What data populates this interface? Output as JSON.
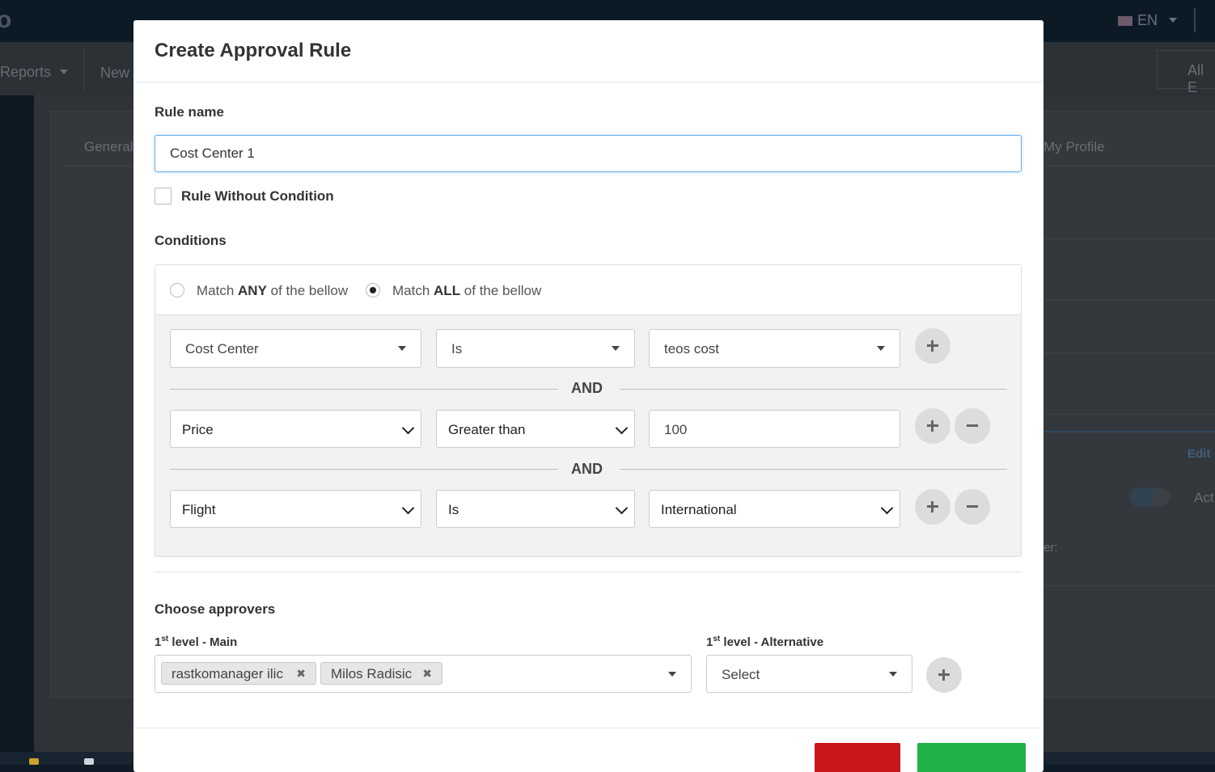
{
  "background": {
    "logo": "o",
    "language": "EN",
    "nav": {
      "reports": "Reports",
      "new": "New",
      "all": "All E"
    },
    "tabs": {
      "general": "General",
      "my_profile": "My Profile"
    },
    "edit": "Edit",
    "active": "Act",
    "er_label": "er:"
  },
  "modal": {
    "title": "Create Approval Rule",
    "rule_name_label": "Rule name",
    "rule_name_value": "Cost Center 1",
    "rule_without_condition_label": "Rule Without Condition",
    "conditions_label": "Conditions",
    "match": {
      "any_pre": "Match ",
      "any_bold": "ANY",
      "any_post": " of the bellow",
      "all_pre": "Match ",
      "all_bold": "ALL",
      "all_post": " of the bellow",
      "selected": "ALL"
    },
    "conditions": [
      {
        "field": "Cost Center",
        "operator": "Is",
        "value": "teos cost"
      },
      {
        "field": "Price",
        "operator": "Greater than",
        "value": "100"
      },
      {
        "field": "Flight",
        "operator": "Is",
        "value": "International"
      }
    ],
    "and_label": "AND",
    "approvers_label": "Choose approvers",
    "level_main": {
      "num": "1",
      "sup": "st",
      "text": " level - Main"
    },
    "level_alt": {
      "num": "1",
      "sup": "st",
      "text": " level - Alternative"
    },
    "main_approvers": [
      "rastkomanager ilic",
      "Milos Radisic"
    ],
    "remove_glyph": "✖",
    "alternative_value": "Select"
  },
  "colors": {
    "focus_border": "#66afe9",
    "cancel_button": "#c9161c",
    "save_button": "#23b24a"
  }
}
